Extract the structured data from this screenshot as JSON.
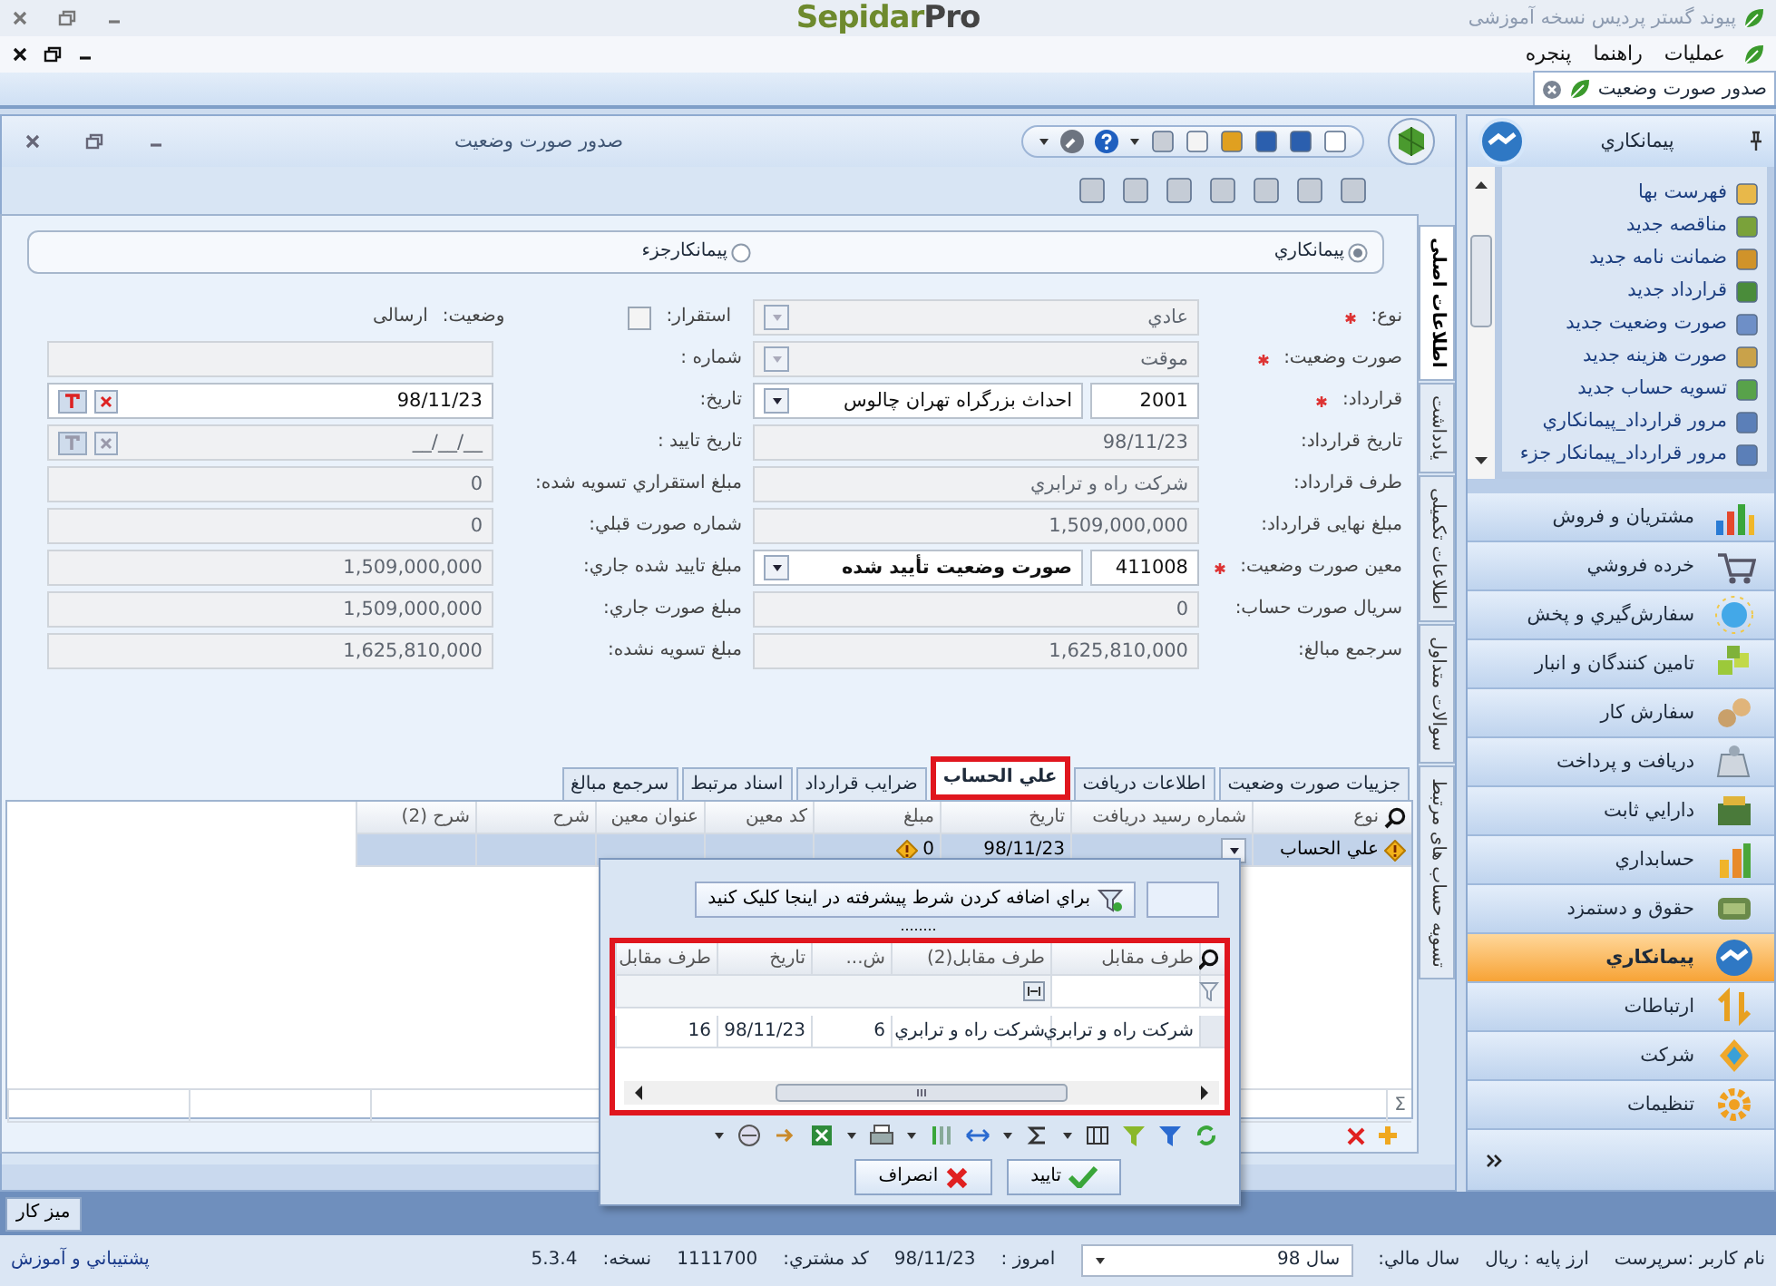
{
  "app_title_bar": {
    "title": "پیوند گستر پردیس نسخه آموزشی",
    "logo": {
      "primary": "Sepidar",
      "secondary": "Pro"
    }
  },
  "menu": [
    {
      "label": "عملیات"
    },
    {
      "label": "راهنما"
    },
    {
      "label": "پنجره"
    }
  ],
  "document_tabs": [
    {
      "label": "صدور صورت وضعیت",
      "selected": true
    }
  ],
  "window": {
    "title": "صدور صورت وضعیت"
  },
  "side_tabs": [
    {
      "label": "اطلاعات اصلی",
      "selected": true
    },
    {
      "label": "یادداشت",
      "selected": false
    },
    {
      "label": "اطلاعات تکمیلی",
      "selected": false
    },
    {
      "label": "سوالات متداول",
      "selected": false
    },
    {
      "label": "تسویه حساب های مرتبط",
      "selected": false
    }
  ],
  "contractor_type": [
    {
      "label": "پیمانکاري",
      "selected": true
    },
    {
      "label": "پیمانکارجزء",
      "selected": false
    }
  ],
  "fields_right": [
    {
      "kind": "select",
      "label": "نوع:",
      "required": true,
      "value": "عادي",
      "disabled": true
    },
    {
      "kind": "select",
      "label": "صورت وضعیت:",
      "required": true,
      "value": "موقت",
      "disabled": true
    },
    {
      "kind": "lookup",
      "label": "قرارداد:",
      "required": true,
      "code": "2001",
      "value": "احداث بزرگراه تهران چالوس",
      "bold": false,
      "disabled": false
    },
    {
      "kind": "text",
      "label": "تاریخ قرارداد:",
      "required": false,
      "value": "98/11/23",
      "disabled": true
    },
    {
      "kind": "text",
      "label": "طرف قرارداد:",
      "required": false,
      "value": "شرکت راه و ترابري",
      "disabled": true
    },
    {
      "kind": "text",
      "label": "مبلغ نهایی قرارداد:",
      "required": false,
      "value": "1,509,000,000",
      "disabled": true
    },
    {
      "kind": "lookup",
      "label": "معین صورت وضعیت:",
      "required": true,
      "code": "411008",
      "value": "صورت وضعیت تأیید شده",
      "bold": true,
      "disabled": false
    },
    {
      "kind": "text",
      "label": "سریال صورت حساب:",
      "required": false,
      "value": "0",
      "disabled": true
    },
    {
      "kind": "text",
      "label": "سرجمع مبالغ:",
      "required": false,
      "value": "1,625,810,000",
      "disabled": true
    }
  ],
  "fields_left": [
    {
      "kind": "check_status",
      "label": "استقرار:",
      "checked": false,
      "status_label": "وضعیت:",
      "status_value": "ارسالی"
    },
    {
      "kind": "text",
      "label": "شماره :",
      "disabled": true
    },
    {
      "kind": "date",
      "label": "تاریخ:",
      "value": "98/11/23",
      "disabled": false
    },
    {
      "kind": "date",
      "label": "تاریخ تایید :",
      "value": "__/__/__",
      "disabled": true
    },
    {
      "kind": "text",
      "label": "مبلغ استقراري تسویه شده:",
      "value": "0",
      "disabled": true
    },
    {
      "kind": "text",
      "label": "شماره صورت قبلي:",
      "value": "0",
      "disabled": true
    },
    {
      "kind": "text",
      "label": "مبلغ تایید شده جاري:",
      "value": "1,509,000,000",
      "disabled": true
    },
    {
      "kind": "text",
      "label": "مبلغ صورت جاري:",
      "value": "1,509,000,000",
      "disabled": true
    },
    {
      "kind": "text",
      "label": "مبلغ تسویه نشده:",
      "value": "1,625,810,000",
      "disabled": true
    }
  ],
  "detail_tabs": [
    {
      "label": "جزییات صورت وضعیت",
      "selected": false,
      "highlighted": false
    },
    {
      "label": "اطلاعات دریافت",
      "selected": false,
      "highlighted": false
    },
    {
      "label": "علي الحساب",
      "selected": true,
      "highlighted": true
    },
    {
      "label": "ضرایب قرارداد",
      "selected": false,
      "highlighted": false
    },
    {
      "label": "اسناد مرتبط",
      "selected": false,
      "highlighted": false
    },
    {
      "label": "سرجمع مبالغ",
      "selected": false,
      "highlighted": false
    }
  ],
  "grid": {
    "columns": [
      "نوع",
      "شماره رسید دریافت",
      "تاریخ",
      "مبلغ",
      "کد معین",
      "عنوان معین",
      "شرح",
      "شرح (2)"
    ],
    "rows": [
      {
        "type": "علي الحساب",
        "date": "98/11/23",
        "amount": "0",
        "selected": true
      }
    ],
    "footer_symbol": "Σ"
  },
  "lookup_popup": {
    "filter_hint": "براي اضافه کردن شرط پیشرفته در اینجا کلیک کنید",
    "highlighted": true,
    "columns": [
      "طرف مقابل",
      "طرف مقابل(2)",
      "ش...",
      "تاریخ",
      "طرف مقابل"
    ],
    "rows": [
      {
        "cells": [
          "شرکت راه و ترابري",
          "شرکت راه و ترابري",
          "6",
          "98/11/23",
          "16"
        ]
      }
    ],
    "buttons": [
      {
        "label": "تایید",
        "kind": "ok"
      },
      {
        "label": "انصراف",
        "kind": "cancel"
      }
    ]
  },
  "sidebar": {
    "title": "پیمانکاري",
    "tasks": [
      {
        "label": "فهرست بها"
      },
      {
        "label": "مناقصه جدید"
      },
      {
        "label": "ضمانت نامه جدید"
      },
      {
        "label": "قرارداد جدید"
      },
      {
        "label": "صورت وضعیت جدید"
      },
      {
        "label": "صورت هزینه جدید"
      },
      {
        "label": "تسویه حساب جدید"
      },
      {
        "label": "مرور قرارداد_پیمانکاري"
      },
      {
        "label": "مرور قرارداد_پیمانکار جزء"
      }
    ],
    "modules": [
      {
        "label": "مشتریان و فروش",
        "selected": false
      },
      {
        "label": "خرده فروشي",
        "selected": false
      },
      {
        "label": "سفارش‌گیري و پخش",
        "selected": false
      },
      {
        "label": "تامین کنندگان و انبار",
        "selected": false
      },
      {
        "label": "سفارش کار",
        "selected": false
      },
      {
        "label": "دریافت و پرداخت",
        "selected": false
      },
      {
        "label": "دارایي ثابت",
        "selected": false
      },
      {
        "label": "حسابداري",
        "selected": false
      },
      {
        "label": "حقوق و دستمزد",
        "selected": false
      },
      {
        "label": "پیمانکاري",
        "selected": true
      },
      {
        "label": "ارتباطات",
        "selected": false
      },
      {
        "label": "شرکت",
        "selected": false
      },
      {
        "label": "تنظیمات",
        "selected": false
      }
    ]
  },
  "taskbar": [
    {
      "label": "میز کار"
    }
  ],
  "status_bar": {
    "user": "نام کاربر :سرپرست",
    "currency": "ارز پایه : ریال",
    "fiscal_year_label": "سال مالي:",
    "fiscal_year": "سال 98",
    "today_label": "امروز :",
    "today": "98/11/23",
    "customer_code_label": "کد مشتري:",
    "customer_code": "1111700",
    "version_label": "نسخه:",
    "version": "5.3.4",
    "support_link": "پشتیباني و آموزش"
  }
}
